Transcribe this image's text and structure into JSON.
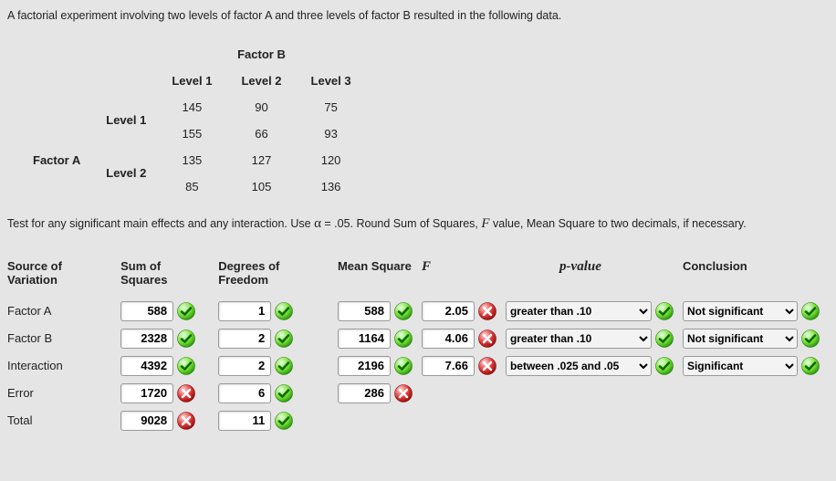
{
  "problem_stmt": "A factorial experiment involving two levels of factor A and three levels of factor B resulted in the following data.",
  "data_table": {
    "factorB_label": "Factor B",
    "factorA_label": "Factor A",
    "col_labels": [
      "Level 1",
      "Level 2",
      "Level 3"
    ],
    "row_labels": [
      "Level 1",
      "Level 2"
    ],
    "cells": {
      "a1b1_r1": "145",
      "a1b2_r1": "90",
      "a1b3_r1": "75",
      "a1b1_r2": "155",
      "a1b2_r2": "66",
      "a1b3_r2": "93",
      "a2b1_r1": "135",
      "a2b2_r1": "127",
      "a2b3_r1": "120",
      "a2b1_r2": "85",
      "a2b2_r2": "105",
      "a2b3_r2": "136"
    }
  },
  "instr_pre": "Test for any significant main effects and any interaction. Use ",
  "instr_alpha": "α",
  "instr_mid": " = .05. Round Sum of Squares, ",
  "instr_f": "F",
  "instr_post": " value, Mean Square to two decimals, if necessary.",
  "headers": {
    "sov": "Source of Variation",
    "ss": "Sum of Squares",
    "df": "Degrees of Freedom",
    "ms": "Mean Square",
    "f": "F",
    "p": "p-value",
    "conc": "Conclusion"
  },
  "rows": {
    "factor_a": "Factor A",
    "factor_b": "Factor B",
    "interaction": "Interaction",
    "error": "Error",
    "total": "Total"
  },
  "vals": {
    "a_ss": "588",
    "a_df": "1",
    "a_ms": "588",
    "a_f": "2.05",
    "a_p": "greater than .10",
    "a_c": "Not significant",
    "b_ss": "2328",
    "b_df": "2",
    "b_ms": "1164",
    "b_f": "4.06",
    "b_p": "greater than .10",
    "b_c": "Not significant",
    "i_ss": "4392",
    "i_df": "2",
    "i_ms": "2196",
    "i_f": "7.66",
    "i_p": "between .025 and .05",
    "i_c": "Significant",
    "e_ss": "1720",
    "e_df": "6",
    "e_ms": "286",
    "t_ss": "9028",
    "t_df": "11"
  },
  "marks": {
    "a_ss": "ok",
    "a_df": "ok",
    "a_ms": "ok",
    "a_f": "bad",
    "a_p": "ok",
    "a_c": "ok",
    "b_ss": "ok",
    "b_df": "ok",
    "b_ms": "ok",
    "b_f": "bad",
    "b_p": "ok",
    "b_c": "ok",
    "i_ss": "ok",
    "i_df": "ok",
    "i_ms": "ok",
    "i_f": "bad",
    "i_p": "ok",
    "i_c": "ok",
    "e_ss": "bad",
    "e_df": "ok",
    "e_ms": "bad",
    "t_ss": "bad",
    "t_df": "ok"
  },
  "chart_data": {
    "type": "table",
    "title": "ANOVA table for two-factor factorial experiment",
    "columns": [
      "Source of Variation",
      "Sum of Squares",
      "Degrees of Freedom",
      "Mean Square",
      "F",
      "p-value",
      "Conclusion"
    ],
    "rows": [
      [
        "Factor A",
        588,
        1,
        588,
        2.05,
        "greater than .10",
        "Not significant"
      ],
      [
        "Factor B",
        2328,
        2,
        1164,
        4.06,
        "greater than .10",
        "Not significant"
      ],
      [
        "Interaction",
        4392,
        2,
        2196,
        7.66,
        "between .025 and .05",
        "Significant"
      ],
      [
        "Error",
        1720,
        6,
        286,
        null,
        null,
        null
      ],
      [
        "Total",
        9028,
        11,
        null,
        null,
        null,
        null
      ]
    ],
    "raw_data": {
      "factor_a_levels": 2,
      "factor_b_levels": 3,
      "observations": {
        "A1_B1": [
          145,
          155
        ],
        "A1_B2": [
          90,
          66
        ],
        "A1_B3": [
          75,
          93
        ],
        "A2_B1": [
          135,
          85
        ],
        "A2_B2": [
          127,
          105
        ],
        "A2_B3": [
          120,
          136
        ]
      }
    }
  }
}
